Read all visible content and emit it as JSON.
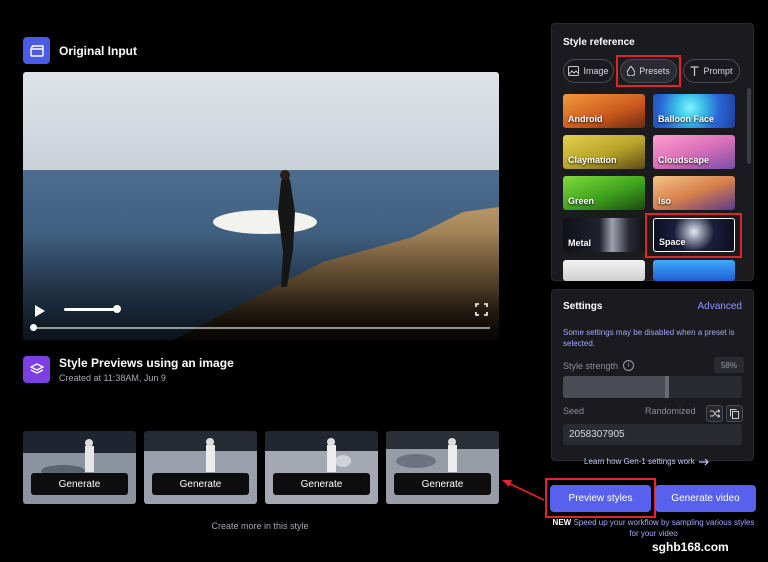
{
  "original_input": {
    "title": "Original Input",
    "icon": "clapperboard-icon",
    "video": {
      "progress": 0.0,
      "volume": 0.95
    }
  },
  "style_previews": {
    "title": "Style Previews using an image",
    "created": "Created at 11:38AM, Jun 9",
    "icon": "layers-icon",
    "thumbnails": [
      {
        "button_label": "Generate"
      },
      {
        "button_label": "Generate"
      },
      {
        "button_label": "Generate"
      },
      {
        "button_label": "Generate"
      }
    ],
    "create_more": "Create more in this style"
  },
  "style_reference": {
    "title": "Style reference",
    "tabs": [
      {
        "label": "Image",
        "icon": "image-icon",
        "active": false
      },
      {
        "label": "Presets",
        "icon": "droplet-icon",
        "active": true
      },
      {
        "label": "Prompt",
        "icon": "text-t-icon",
        "active": false
      }
    ],
    "presets": [
      {
        "label": "Android"
      },
      {
        "label": "Balloon Face"
      },
      {
        "label": "Claymation"
      },
      {
        "label": "Cloudscape"
      },
      {
        "label": "Green"
      },
      {
        "label": "Iso"
      },
      {
        "label": "Metal"
      },
      {
        "label": "Space",
        "selected": true
      },
      {
        "label": ""
      },
      {
        "label": ""
      }
    ]
  },
  "settings": {
    "title": "Settings",
    "advanced": "Advanced",
    "note": "Some settings may be disabled when a preset is selected.",
    "strength_label": "Style strength",
    "strength_value": "58%",
    "strength_fraction": 0.58,
    "seed_label": "Seed",
    "randomized_label": "Randomized",
    "seed_value": "2058307905",
    "learn_link": "Learn how Gen-1 settings work"
  },
  "actions": {
    "preview": "Preview styles",
    "generate": "Generate video",
    "promo_new": "NEW",
    "promo_text": "Speed up your workflow by sampling various styles for your video"
  },
  "watermark": "sghb168.com",
  "colors": {
    "accent": "#5761ee",
    "highlight": "#e0242b",
    "panel": "#1a1a1f"
  }
}
